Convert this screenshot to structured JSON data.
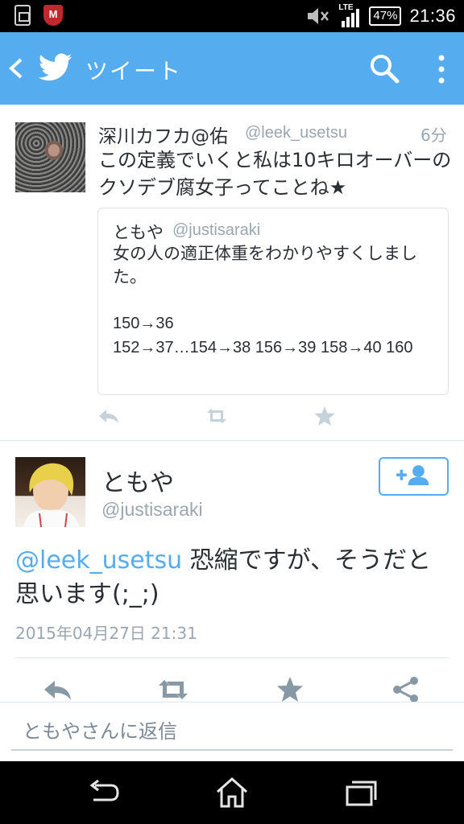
{
  "status_bar": {
    "antivirus_label": "M",
    "network": "LTE",
    "battery": "47%",
    "time": "21:36"
  },
  "app_bar": {
    "title": "ツイート"
  },
  "original_tweet": {
    "author_name": "深川カフカ@佑",
    "author_handle": "@leek_usetsu",
    "time_ago": "6分",
    "text": "この定義でいくと私は10キロオーバーのクソデブ腐女子ってことね★",
    "quoted": {
      "author_name": "ともや",
      "author_handle": "@justisaraki",
      "text": "女の人の適正体重をわかりやすくしました。",
      "line1": "150→36",
      "line2": "152→37…154→38 156→39 158→40 160"
    }
  },
  "reply_tweet": {
    "author_name": "ともや",
    "author_handle": "@justisaraki",
    "mention": "@leek_usetsu",
    "text": " 恐縮ですが、そうだと思います(;_;)",
    "date": "2015年04月27日 21:31"
  },
  "reply_box": {
    "placeholder": "ともやさんに返信"
  },
  "colors": {
    "twitter_blue": "#55acee",
    "muted_gray": "#9ba6b0",
    "action_gray": "#aab8c2"
  }
}
